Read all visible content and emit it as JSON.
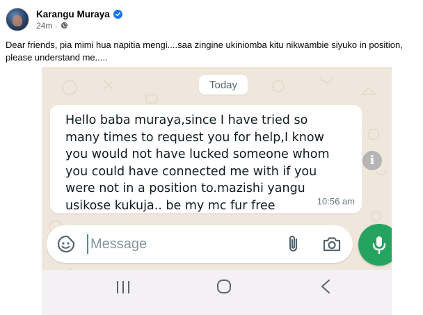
{
  "post": {
    "author": "Karangu Muraya",
    "time": "24m",
    "text": "Dear friends, pia mimi hua napitia mengi....saa zingine ukiniomba kitu nikwambie siyuko in position, please understand me....."
  },
  "chat": {
    "date_label": "Today",
    "message": {
      "text": "Hello baba muraya,since I have tried so many times to request you for help,I know you would not have lucked someone whom you could have connected me with if you were not in a position to.mazishi yangu usikose kukuja.. be my mc fur free",
      "time": "10:56 am"
    },
    "composer": {
      "placeholder": "Message"
    }
  },
  "icons": {
    "verified": "verified-badge-icon",
    "privacy": "globe-icon",
    "info": "info-icon",
    "emoji": "sticker-icon",
    "attach": "paperclip-icon",
    "camera": "camera-icon",
    "mic": "microphone-icon",
    "nav_recent": "recent-apps-icon",
    "nav_home": "home-icon",
    "nav_back": "back-icon"
  },
  "colors": {
    "facebook_blue": "#1877f2",
    "whatsapp_green": "#25a45f",
    "chat_background": "#efe7dc",
    "bubble": "#ffffff"
  }
}
